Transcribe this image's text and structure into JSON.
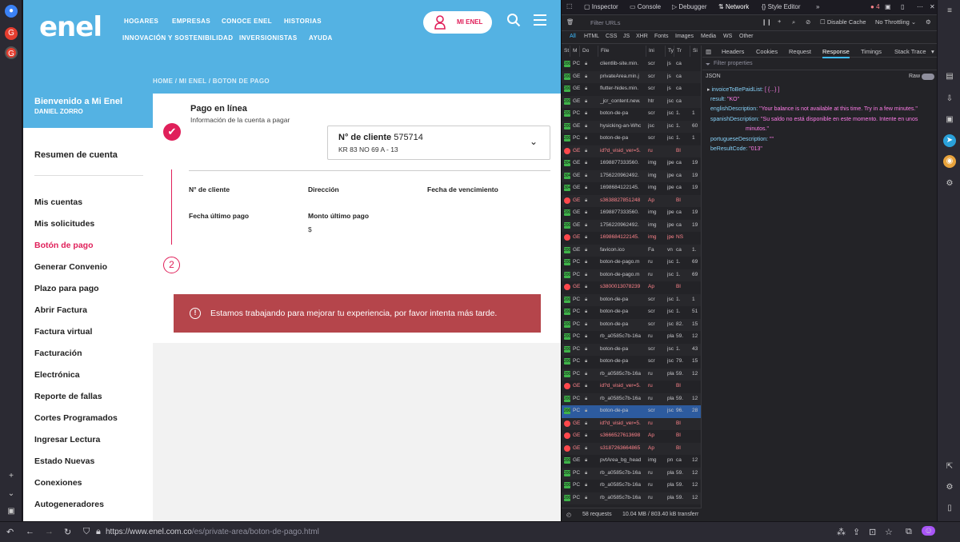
{
  "site": {
    "logo": "enel",
    "nav": [
      "HOGARES",
      "EMPRESAS",
      "CONOCE ENEL",
      "HISTORIAS",
      "INNOVACIÓN Y SOSTENIBILIDAD",
      "INVERSIONISTAS",
      "AYUDA"
    ],
    "mi_enel": "MI ENEL",
    "breadcrumb": "HOME / MI ENEL / BOTON DE PAGO",
    "welcome": "Bienvenido a Mi Enel",
    "user": "DANIEL ZORRO",
    "sidebar_title": "Resumen de cuenta",
    "sidebar_items": [
      "Mis cuentas",
      "Mis solicitudes",
      "Botón de pago",
      "Generar Convenio",
      "Plazo para pago",
      "Abrir Factura",
      "Factura virtual",
      "Facturación",
      "Electrónica",
      "Reporte de fallas",
      "Cortes Programados",
      "Ingresar Lectura",
      "Estado Nuevas",
      "Conexiones",
      "Autogeneradores"
    ],
    "card": {
      "title": "Pago en línea",
      "subtitle": "Información de la cuenta a pagar",
      "client_label": "N° de cliente",
      "client_value": "575714",
      "address": "KR 83 NO 69 A - 13",
      "fields": [
        "N° de cliente",
        "Dirección",
        "Fecha de vencimiento",
        "Fecha último pago",
        "Monto último pago"
      ],
      "amount": "$",
      "step": "2",
      "alert": "Estamos trabajando para mejorar tu experiencia, por favor intenta más tarde."
    }
  },
  "devtools": {
    "tabs": [
      "Inspector",
      "Console",
      "Debugger",
      "Network",
      "Style Editor"
    ],
    "error_count": "4",
    "filter_placeholder": "Filter URLs",
    "disable_cache": "Disable Cache",
    "throttling": "No Throttling",
    "types": [
      "All",
      "HTML",
      "CSS",
      "JS",
      "XHR",
      "Fonts",
      "Images",
      "Media",
      "WS",
      "Other"
    ],
    "columns": [
      "St",
      "M",
      "Do",
      "File",
      "Ini",
      "Ty",
      "Tr",
      "Si"
    ],
    "requests": [
      [
        "200",
        "PC",
        "clientlib-site.min.",
        "scr",
        "js",
        "ca",
        ""
      ],
      [
        "200",
        "GE",
        "privateArea.min.j",
        "scr",
        "js",
        "ca",
        ""
      ],
      [
        "200",
        "GE",
        "flutter-hides.min.",
        "scr",
        "js",
        "ca",
        ""
      ],
      [
        "200",
        "GE",
        "_jcr_content.new.",
        "htr",
        "jsc",
        "ca",
        ""
      ],
      [
        "200",
        "PC",
        "boton-de-pa",
        "scr",
        "jsc",
        "1.",
        "1"
      ],
      [
        "200",
        "GE",
        "hysicking-an-Whc",
        "jsc",
        "jsc",
        "1.",
        "60"
      ],
      [
        "200",
        "PC",
        "boton-de-pa",
        "scr",
        "jsc",
        "1.",
        "1"
      ],
      [
        "err",
        "GE",
        "id?d_visid_ver=5.",
        "ru",
        "",
        "Bl",
        ""
      ],
      [
        "304",
        "GE",
        "1698877333560.",
        "img",
        "jpe",
        "ca",
        "19"
      ],
      [
        "304",
        "GE",
        "1756220962492.",
        "img",
        "jpe",
        "ca",
        "19"
      ],
      [
        "304",
        "GE",
        "1698684122145.",
        "img",
        "jpe",
        "ca",
        "19"
      ],
      [
        "err",
        "GE",
        "s3638827851248",
        "Ap",
        "",
        "Bl",
        ""
      ],
      [
        "200",
        "GE",
        "1698877333560.",
        "img",
        "jpe",
        "ca",
        "19"
      ],
      [
        "200",
        "GE",
        "1756220962492.",
        "img",
        "jpe",
        "ca",
        "19"
      ],
      [
        "err",
        "GE",
        "1698684122145.",
        "img",
        "jpe",
        "NS",
        ""
      ],
      [
        "200",
        "GE",
        "favicon.ico",
        "Fa",
        "vn",
        "ca",
        "1."
      ],
      [
        "200",
        "PC",
        "boton-de-pago.m",
        "ru",
        "jsc",
        "1.",
        "69"
      ],
      [
        "200",
        "PC",
        "boton-de-pago.m",
        "ru",
        "jsc",
        "1.",
        "69"
      ],
      [
        "err",
        "GE",
        "s3800013078239",
        "Ap",
        "",
        "Bl",
        ""
      ],
      [
        "200",
        "PC",
        "boton-de-pa",
        "scr",
        "jsc",
        "1.",
        "1"
      ],
      [
        "200",
        "PC",
        "boton-de-pa",
        "scr",
        "jsc",
        "1.",
        "51"
      ],
      [
        "200",
        "PC",
        "boton-de-pa",
        "scr",
        "jsc",
        "82.",
        "15"
      ],
      [
        "200",
        "PC",
        "rb_a0585c7b-16a",
        "ru",
        "pla",
        "59.",
        "12"
      ],
      [
        "200",
        "PC",
        "boton-de-pa",
        "scr",
        "jsc",
        "1.",
        "43"
      ],
      [
        "200",
        "PC",
        "boton-de-pa",
        "scr",
        "jsc",
        "79.",
        "15"
      ],
      [
        "200",
        "PC",
        "rb_a0585c7b-16a",
        "ru",
        "pla",
        "59.",
        "12"
      ],
      [
        "err",
        "GE",
        "id?d_visid_ver=5.",
        "ru",
        "",
        "Bl",
        ""
      ],
      [
        "200",
        "PC",
        "rb_a0585c7b-16a",
        "ru",
        "pla",
        "59.",
        "12"
      ],
      [
        "200",
        "PC",
        "boton-de-pa",
        "scr",
        "jsc",
        "96.",
        "28"
      ],
      [
        "err",
        "GE",
        "id?d_visid_ver=5.",
        "ru",
        "",
        "Bl",
        ""
      ],
      [
        "err",
        "GE",
        "s3666527613698",
        "Ap",
        "",
        "Bl",
        ""
      ],
      [
        "err",
        "GE",
        "s3187263664865",
        "Ap",
        "",
        "Bl",
        ""
      ],
      [
        "200",
        "GE",
        "pvtArea_bg_head",
        "img",
        "pn",
        "ca",
        "12"
      ],
      [
        "200",
        "PC",
        "rb_a0585c7b-16a",
        "ru",
        "pla",
        "59.",
        "12"
      ],
      [
        "200",
        "PC",
        "rb_a0585c7b-16a",
        "ru",
        "pla",
        "59.",
        "12"
      ],
      [
        "200",
        "PC",
        "rb_a0585c7b-16a",
        "ru",
        "pla",
        "59.",
        "12"
      ]
    ],
    "footer": [
      "58 requests",
      "10.04 MB / 803.40 kB transferr"
    ],
    "detail_tabs": [
      "Headers",
      "Cookies",
      "Request",
      "Response",
      "Timings",
      "Stack Trace"
    ],
    "filter_props": "Filter properties",
    "json_label": "JSON",
    "raw_label": "Raw",
    "json": [
      {
        "k": "invoiceToBePaidList:",
        "v": "[ {...} ]"
      },
      {
        "k": "result:",
        "v": "\"KO\""
      },
      {
        "k": "englishDescription:",
        "v": "\"Your balance is not available at this time. Try in a few minutes.\""
      },
      {
        "k": "spanishDescription:",
        "v": "\"Su saldo no está disponible en este momento. Intente en unos"
      },
      {
        "k": "",
        "v": "minutos.\""
      },
      {
        "k": "portugueseDescription:",
        "v": "\"\""
      },
      {
        "k": "beResultCode:",
        "v": "\"013\""
      }
    ]
  },
  "browser": {
    "url_host": "https://www.enel.com.co",
    "url_path": "/es/private-area/boton-de-pago.html"
  }
}
